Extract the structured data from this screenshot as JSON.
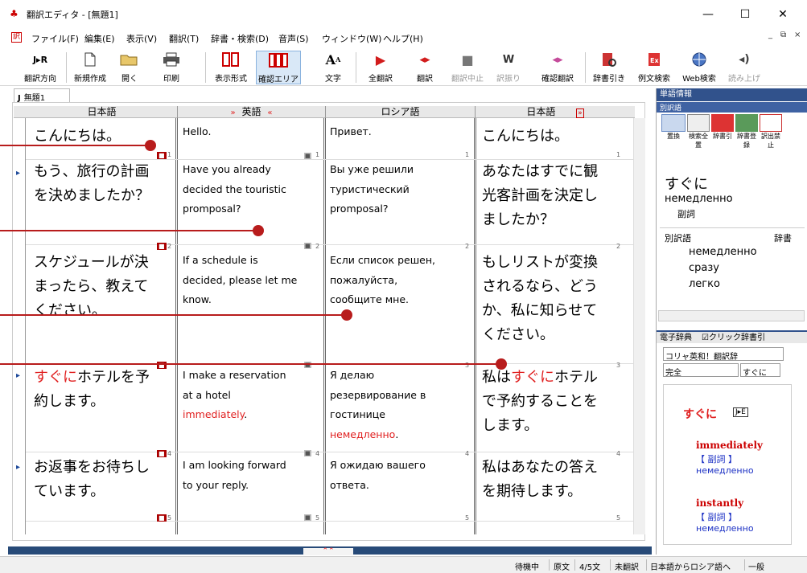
{
  "window": {
    "title": "翻訳エディタ - [無題1]",
    "minimize": "—",
    "maximize": "☐",
    "close": "✕"
  },
  "menu": {
    "items": [
      "ファイル(F)",
      "編集(E)",
      "表示(V)",
      "翻訳(T)",
      "辞書・検索(D)",
      "音声(S)",
      "ウィンドウ(W)",
      "ヘルプ(H)"
    ],
    "mdi_min": "_",
    "mdi_restore": "⧉",
    "mdi_close": "×"
  },
  "toolbar": {
    "direction_icon": "J▸R",
    "items": {
      "direction": "翻訳方向",
      "new": "新規作成",
      "open": "開く",
      "print": "印刷",
      "display_format": "表示形式",
      "confirm_area": "確認エリア",
      "font": "文字",
      "translate_all": "全翻訳",
      "translate": "翻訳",
      "stop": "翻訳中止",
      "furigana": "訳振り",
      "confirm_translate": "確認翻訳",
      "dict_lookup": "辞書引き",
      "example_search": "例文検索",
      "web_search": "Web検索",
      "read_aloud": "読み上げ"
    }
  },
  "document": {
    "tab_label": "無題1",
    "tab_prefix": "J",
    "columns": [
      "日本語",
      "英語",
      "ロシア語",
      "日本語"
    ],
    "column_markers": {
      "left": "»",
      "right": "«",
      "end": "»"
    },
    "rows": [
      {
        "num": "1",
        "ja": [
          "こんにちは。"
        ],
        "en": [
          "Hello."
        ],
        "ru": [
          "Привет."
        ],
        "ja2": [
          "こんにちは。"
        ]
      },
      {
        "num": "2",
        "ja": [
          "もう、旅行の計画",
          "を決めましたか？"
        ],
        "en": [
          "Have you already",
          "decided the touristic",
          "promposal?"
        ],
        "ru": [
          "Вы уже решили",
          "туристический",
          "promposal?"
        ],
        "ja2": [
          "あなたはすでに観",
          "光客計画を決定し",
          "ましたか？"
        ]
      },
      {
        "num": "3",
        "ja": [
          "スケジュールが決",
          "まったら、教えて",
          "ください。"
        ],
        "en": [
          "If a schedule is",
          "decided, please let me",
          "know."
        ],
        "ru": [
          "Если список решен,",
          "пожалуйста,",
          "сообщите мне."
        ],
        "ja2": [
          "もしリストが変換",
          "されるなら、どう",
          "か、私に知らせて",
          "ください。"
        ]
      },
      {
        "num": "4",
        "ja_pre": "",
        "ja_red": "すぐに",
        "ja_post": "ホテルを予",
        "ja_line2": "約します。",
        "en_l1": "I make a reservation",
        "en_l2": "at a hotel",
        "en_red": "immediately",
        "en_dot": ".",
        "ru_l1": "Я делаю",
        "ru_l2": "резервирование в",
        "ru_l3": "гостинице",
        "ru_red": "немедленно",
        "ru_dot": ".",
        "ja2_pre": "私は",
        "ja2_red": "すぐに",
        "ja2_post": "ホテル",
        "ja2_l2": "で予約することを",
        "ja2_l3": "します。"
      },
      {
        "num": "5",
        "ja": [
          "お返事をお待ちし",
          "ています。"
        ],
        "en": [
          "I am looking forward",
          "to your reply."
        ],
        "ru": [
          "Я ожидаю вашего",
          "ответа."
        ],
        "ja2": [
          "私はあなたの答え",
          "を期待します。"
        ]
      }
    ]
  },
  "side_panel": {
    "word_info_title": "単語情報",
    "alt_title": "別訳語",
    "tools": [
      "置換",
      "検索全置",
      "辞書引",
      "辞書登録",
      "訳出禁止"
    ],
    "headword": "すぐに",
    "headword_ru": "немедленно",
    "pos": "副詞",
    "alt_header_left": "別訳語",
    "alt_header_right": "辞書",
    "alternatives": [
      "немедленно",
      "сразу",
      "легко"
    ],
    "edict_title": "電子辞典",
    "click_dict": "☑クリック辞書引",
    "dict_select": "コリャ英和！翻訳辞",
    "match_select": "完全",
    "search_value": "すぐに",
    "entry_head": "すぐに",
    "entry_tag": "J▸E",
    "entries": [
      {
        "word": "immediately",
        "pos": "【 副詞 】",
        "ru": "немедленно",
        "tag": "E"
      },
      {
        "word": "instantly",
        "pos": "【 副詞 】",
        "ru": "немедленно",
        "tag": "E▸R"
      }
    ]
  },
  "status": {
    "state": "待機中",
    "mode": "原文",
    "progress": "4/5文",
    "untranslated": "未翻訳",
    "direction": "日本語からロシア語へ",
    "field": "一般"
  },
  "colors": {
    "accent_red": "#e02020",
    "callout": "#b81c1c",
    "panel_header": "#31528c",
    "dict_blue": "#1a2fc4"
  }
}
